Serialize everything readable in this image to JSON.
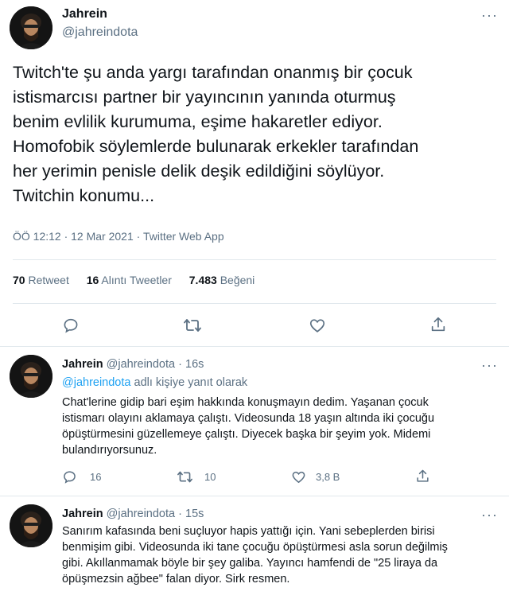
{
  "main_tweet": {
    "name": "Jahrein",
    "handle": "@jahreindota",
    "more": "···",
    "text": "Twitch'te şu anda yargı tarafından onanmış bir çocuk\nistismarcısı partner bir yayıncının yanında oturmuş\nbenim evlilik kurumuma, eşime hakaretler ediyor.\nHomofobik söylemlerde bulunarak erkekler tarafından\nher yerimin penisle delik deşik edildiğini söylüyor.\nTwitchin konumu...",
    "meta": "ÖÖ 12:12 · 12 Mar 2021 · Twitter Web App",
    "stats": {
      "retweets": "70",
      "retweets_label": "Retweet",
      "quotes": "16",
      "quotes_label": "Alıntı Tweetler",
      "likes": "7.483",
      "likes_label": "Beğeni"
    },
    "actions": [
      "reply-icon",
      "retweet-icon",
      "like-icon",
      "share-icon"
    ]
  },
  "replies": [
    {
      "name": "Jahrein",
      "handle": "@jahreindota",
      "sep": "·",
      "time": "16s",
      "more": "···",
      "reply_to_handle": "@jahreindota",
      "reply_to_suffix": "adlı kişiye yanıt olarak",
      "lines": [
        "Chat'lerine gidip bari eşim hakkında konuşmayın dedim. Yaşanan çocuk",
        "istismarı olayını aklamaya çalıştı. Videosunda 18 yaşın altında iki çocuğu",
        "öpüştürmesini güzellemeye çalıştı. Diyecek başka bir şeyim yok. Midemi",
        "bulandırıyorsunuz."
      ],
      "reply_count": "16",
      "retweet_count": "10",
      "like_count": "3,8 B"
    },
    {
      "name": "Jahrein",
      "handle": "@jahreindota",
      "sep": "·",
      "time": "15s",
      "more": "···",
      "lines": [
        "Sanırım kafasında beni suçluyor hapis yattığı için. Yani sebeplerden birisi",
        "benmişim gibi. Videosunda iki tane çocuğu öpüştürmesi asla sorun değilmiş",
        "gibi. Akıllanmamak böyle bir şey galiba. Yayıncı hamfendi de \"25 liraya da",
        "öpüşmezsin ağbee\" falan diyor. Sirk resmen."
      ]
    }
  ],
  "colors": {
    "text": "#0f1419",
    "secondary": "#5b7083",
    "link": "#1da1f2",
    "divider": "#e1e8ed"
  }
}
